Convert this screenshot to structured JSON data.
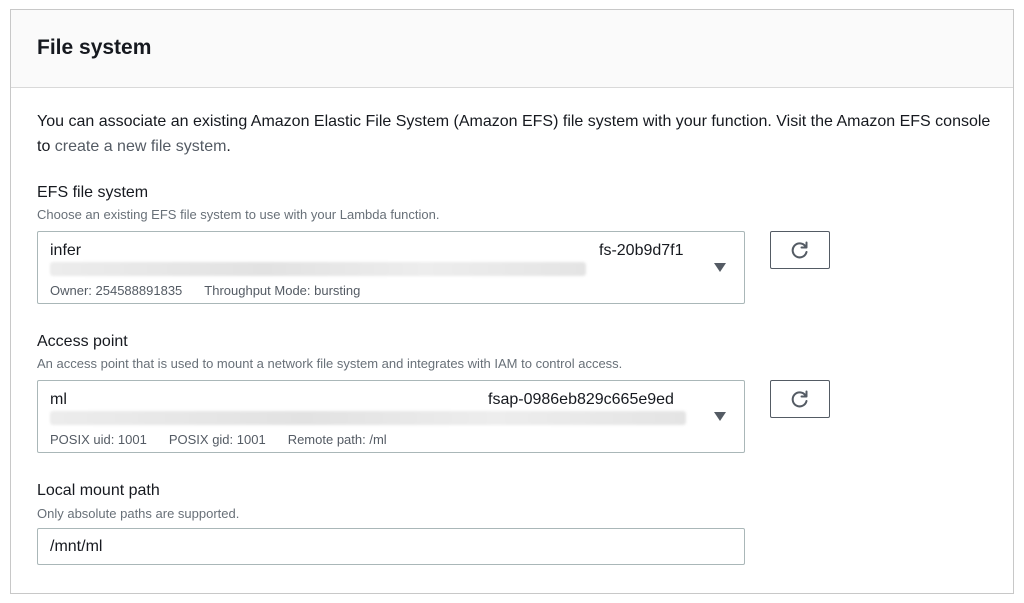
{
  "panel": {
    "title": "File system"
  },
  "intro": {
    "text_before": "You can associate an existing Amazon Elastic File System (Amazon EFS) file system with your function. Visit the Amazon EFS console to ",
    "link": "create a new file system",
    "text_after": "."
  },
  "efs": {
    "label": "EFS file system",
    "description": "Choose an existing EFS file system to use with your Lambda function.",
    "selected_name": "infer",
    "selected_id": "fs-20b9d7f1",
    "owner": "Owner: 254588891835",
    "throughput": "Throughput Mode: bursting",
    "refresh_icon": "refresh-icon"
  },
  "access_point": {
    "label": "Access point",
    "description": "An access point that is used to mount a network file system and integrates with IAM to control access.",
    "selected_name": "ml",
    "selected_id": "fsap-0986eb829c665e9ed",
    "uid": "POSIX uid: 1001",
    "gid": "POSIX gid: 1001",
    "remote_path": "Remote path: /ml",
    "refresh_icon": "refresh-icon"
  },
  "mount": {
    "label": "Local mount path",
    "description": "Only absolute paths are supported.",
    "value": "/mnt/ml"
  }
}
